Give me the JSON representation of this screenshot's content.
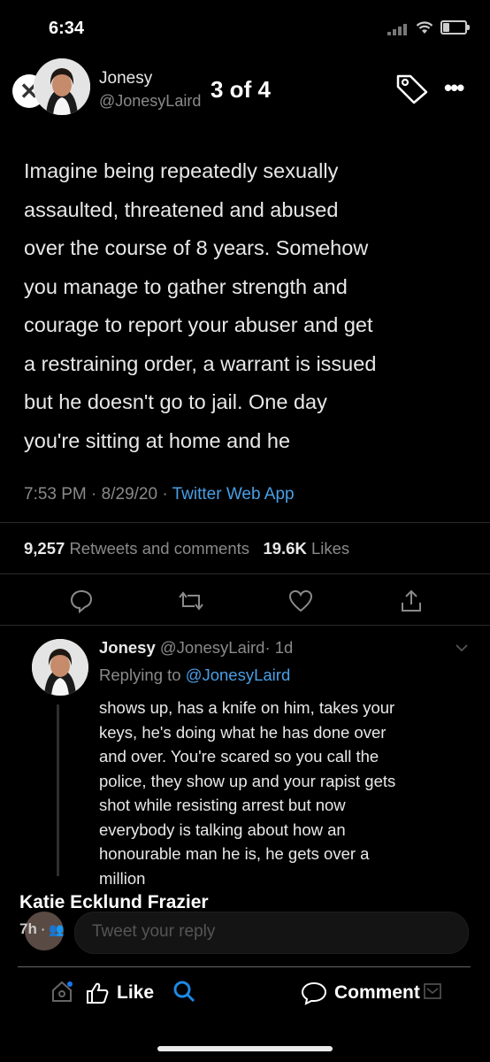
{
  "status_bar": {
    "time": "6:34"
  },
  "viewer": {
    "counter": "3 of 4"
  },
  "tweet": {
    "author_name": "Jonesy",
    "author_handle": "@JonesyLaird",
    "lines": [
      "Imagine being repeatedly sexually",
      "assaulted, threatened and abused",
      "over the course of 8 years. Somehow",
      "you manage to gather strength and",
      "courage to report your abuser and get",
      "a restraining order, a warrant is issued",
      "but he doesn't go to jail. One day",
      "you're sitting at home and he"
    ],
    "time": "7:53 PM",
    "date": "8/29/20",
    "sep": "·",
    "app": "Twitter Web App",
    "retweets_count": "9,257",
    "retweets_label": "Retweets and comments",
    "likes_count": "19.6K",
    "likes_label": "Likes"
  },
  "reply": {
    "author_name": "Jonesy",
    "author_handle": "@JonesyLaird",
    "age": "· 1d",
    "replying_label": "Replying to",
    "replying_to": "@JonesyLaird",
    "lines": [
      "shows up, has a knife on him, takes your",
      "keys, he's doing what he has done over",
      "and over. You're scared so you call the",
      "police, they show up and your rapist gets",
      "shot while resisting arrest but now",
      "everybody is talking about how an",
      "honourable man he is, he gets over a",
      "million"
    ],
    "reply_placeholder": "Tweet your reply"
  },
  "facebook": {
    "poster_name": "Katie Ecklund Frazier",
    "post_time": "7h",
    "like_label": "Like",
    "comment_label": "Comment"
  },
  "colors": {
    "link": "#4a9fe6",
    "muted": "#8a8a8a",
    "text": "#e8e8e8"
  }
}
